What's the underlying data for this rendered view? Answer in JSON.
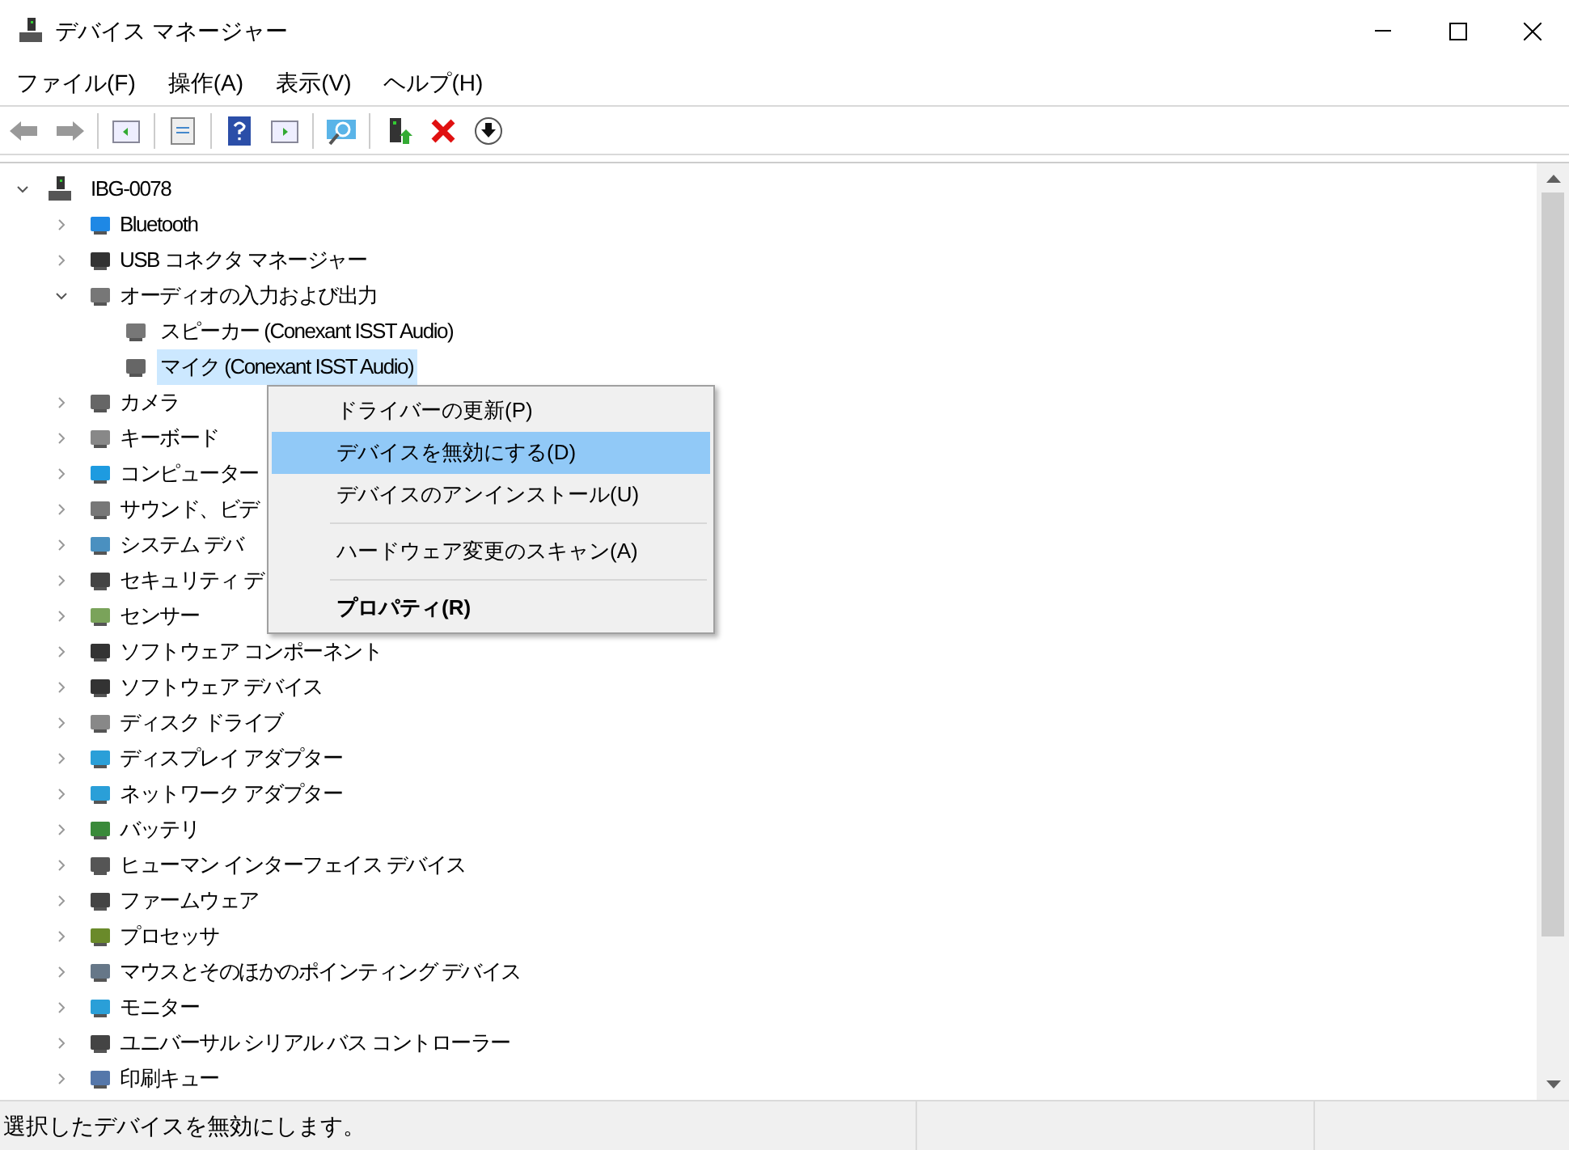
{
  "window": {
    "title": "デバイス マネージャー"
  },
  "menu": [
    "ファイル(F)",
    "操作(A)",
    "表示(V)",
    "ヘルプ(H)"
  ],
  "tree": {
    "label": "IBG-0078",
    "expanded": true,
    "children": [
      {
        "label": "Bluetooth",
        "expanded": false,
        "selected": false
      },
      {
        "label": "USB コネクタ マネージャー",
        "expanded": false,
        "selected": false
      },
      {
        "label": "オーディオの入力および出力",
        "expanded": true,
        "selected": false,
        "children": [
          {
            "label": "スピーカー (Conexant ISST Audio)",
            "selected": false
          },
          {
            "label": "マイク (Conexant ISST Audio)",
            "selected": true
          }
        ]
      },
      {
        "label": "カメラ",
        "expanded": false,
        "selected": false
      },
      {
        "label": "キーボード",
        "expanded": false,
        "selected": false
      },
      {
        "label": "コンピューター",
        "expanded": false,
        "selected": false
      },
      {
        "label": "サウンド、ビデ",
        "expanded": false,
        "selected": false
      },
      {
        "label": "システム デバ",
        "expanded": false,
        "selected": false
      },
      {
        "label": "セキュリティ デ",
        "expanded": false,
        "selected": false
      },
      {
        "label": "センサー",
        "expanded": false,
        "selected": false
      },
      {
        "label": "ソフトウェア コンポーネント",
        "expanded": false,
        "selected": false
      },
      {
        "label": "ソフトウェア デバイス",
        "expanded": false,
        "selected": false
      },
      {
        "label": "ディスク ドライブ",
        "expanded": false,
        "selected": false
      },
      {
        "label": "ディスプレイ アダプター",
        "expanded": false,
        "selected": false
      },
      {
        "label": "ネットワーク アダプター",
        "expanded": false,
        "selected": false
      },
      {
        "label": "バッテリ",
        "expanded": false,
        "selected": false
      },
      {
        "label": "ヒューマン インターフェイス デバイス",
        "expanded": false,
        "selected": false
      },
      {
        "label": "ファームウェア",
        "expanded": false,
        "selected": false
      },
      {
        "label": "プロセッサ",
        "expanded": false,
        "selected": false
      },
      {
        "label": "マウスとそのほかのポインティング デバイス",
        "expanded": false,
        "selected": false
      },
      {
        "label": "モニター",
        "expanded": false,
        "selected": false
      },
      {
        "label": "ユニバーサル シリアル バス コントローラー",
        "expanded": false,
        "selected": false
      },
      {
        "label": "印刷キュー",
        "expanded": false,
        "selected": false
      }
    ]
  },
  "context_menu": [
    {
      "kind": "item",
      "label": "ドライバーの更新(P)",
      "selected": false,
      "default": false
    },
    {
      "kind": "item",
      "label": "デバイスを無効にする(D)",
      "selected": true,
      "default": false
    },
    {
      "kind": "item",
      "label": "デバイスのアンインストール(U)",
      "selected": false,
      "default": false
    },
    {
      "kind": "separator"
    },
    {
      "kind": "item",
      "label": "ハードウェア変更のスキャン(A)",
      "selected": false,
      "default": false
    },
    {
      "kind": "separator"
    },
    {
      "kind": "item",
      "label": "プロパティ(R)",
      "selected": false,
      "default": true
    }
  ],
  "status_bar": {
    "text": "選択したデバイスを無効にします。"
  }
}
